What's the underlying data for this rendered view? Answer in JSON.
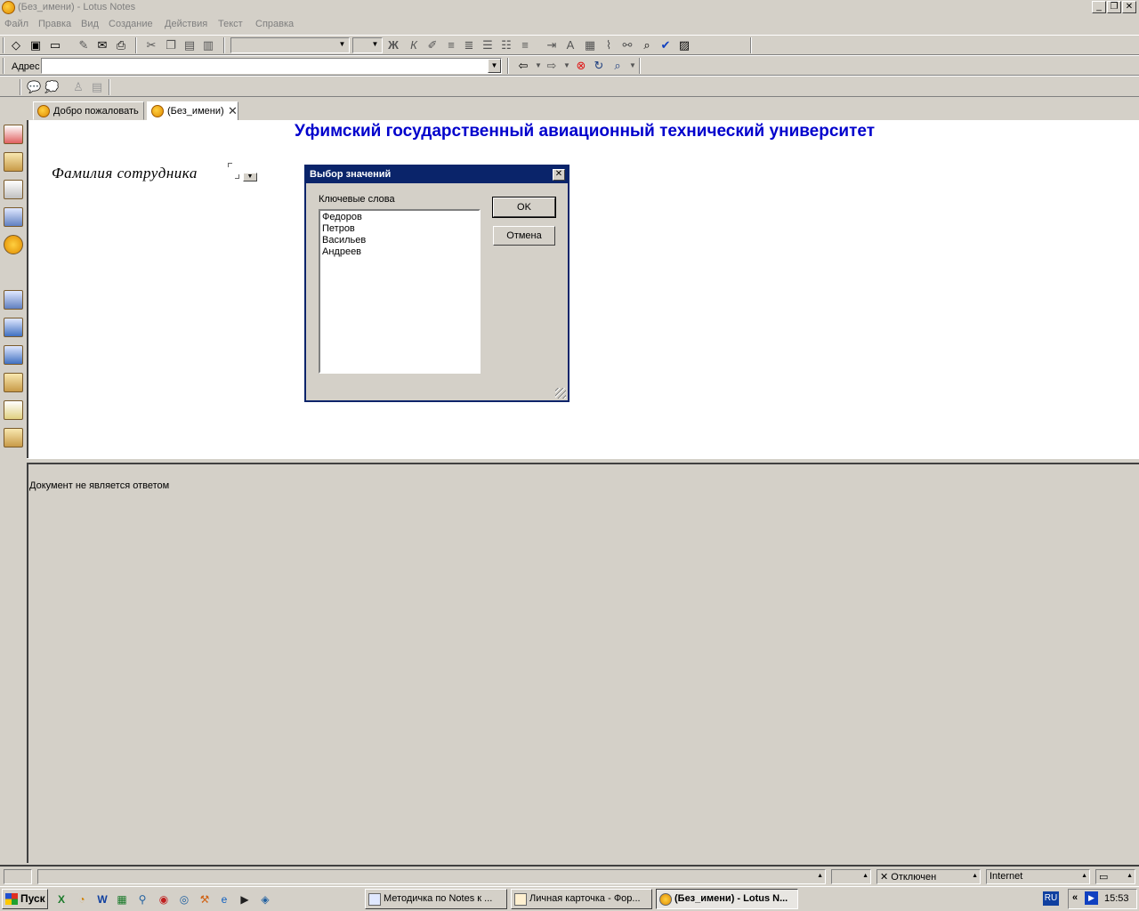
{
  "window": {
    "title": "(Без_имени) - Lotus Notes"
  },
  "menu": [
    "Файл",
    "Правка",
    "Вид",
    "Создание",
    "Действия",
    "Текст",
    "Справка"
  ],
  "address": {
    "label": "Адрес",
    "value": ""
  },
  "tabs": [
    {
      "label": "Добро пожаловать"
    },
    {
      "label": "(Без_имени)"
    }
  ],
  "document": {
    "heading": "Уфимский государственный авиационный технический университет",
    "field_label": "Фамилия  сотрудника",
    "lower_text": "Документ не является ответом"
  },
  "dialog": {
    "title": "Выбор значений",
    "list_label": "Ключевые слова",
    "items": [
      "Федоров",
      "Петров",
      "Васильев",
      "Андреев"
    ],
    "ok_label": "OK",
    "cancel_label": "Отмена"
  },
  "statusbar": {
    "status": "Отключен",
    "zone": "Internet"
  },
  "taskbar": {
    "start_label": "Пуск",
    "tasks": [
      {
        "label": "Методичка по Notes к ..."
      },
      {
        "label": "Личная карточка - Фор..."
      },
      {
        "label": "(Без_имени) - Lotus N..."
      }
    ],
    "lang": "RU",
    "clock": "15:53"
  },
  "colors": {
    "heading": "#0000cc",
    "dialog_title_bg": "#0a246a",
    "chrome": "#d4d0c8"
  }
}
